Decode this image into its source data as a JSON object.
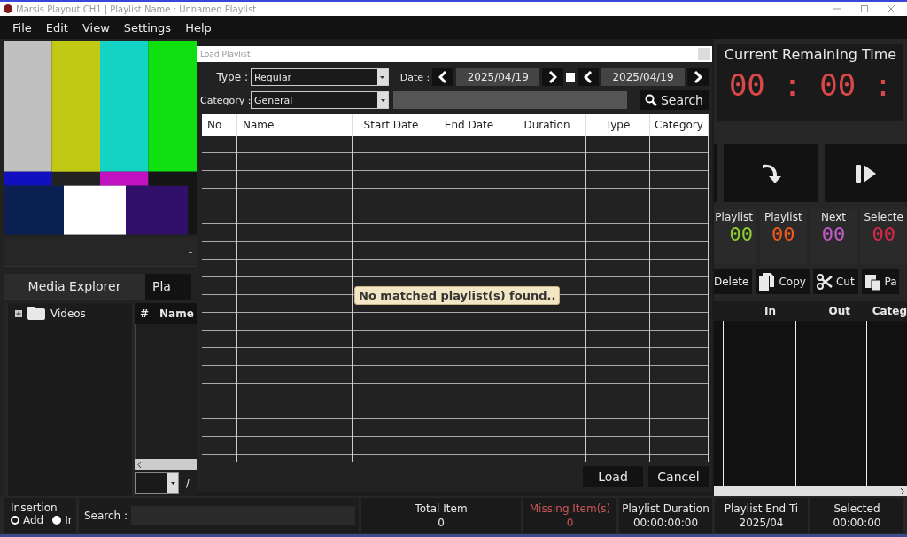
{
  "window": {
    "title": "Marsis Playout CH1 | Playlist Name : Unnamed Playlist"
  },
  "menu": [
    "File",
    "Edit",
    "View",
    "Settings",
    "Help"
  ],
  "preview": {
    "kind": "picture",
    "reading": "-"
  },
  "left_tabs": [
    {
      "label": "Media Explorer",
      "selected": true
    },
    {
      "label": "Pla",
      "selected": false
    }
  ],
  "tree": [
    {
      "label": "Videos",
      "expanded": false
    }
  ],
  "file_list": {
    "columns": [
      "#",
      "Name"
    ],
    "page_separator": "/"
  },
  "remaining_time": {
    "title": "Current Remaining Time",
    "value": "00 : 00 :"
  },
  "counters": [
    {
      "label": "Playlist",
      "value": "00",
      "color": "#8ccf2e"
    },
    {
      "label": "Playlist",
      "value": "00",
      "color": "#f05a1e"
    },
    {
      "label": "Next",
      "value": "00",
      "color": "#c35cc8"
    },
    {
      "label": "Selecte",
      "value": "00",
      "color": "#d8284a"
    }
  ],
  "edit_tools": [
    {
      "label": "Delete",
      "kind": "delete"
    },
    {
      "label": "Copy",
      "kind": "copy"
    },
    {
      "label": "Cut",
      "kind": "cut"
    },
    {
      "label": "Pa",
      "kind": "paste"
    }
  ],
  "playlist_table": {
    "columns": [
      "In",
      "Out",
      "Categ"
    ]
  },
  "insertion": {
    "title": "Insertion",
    "options": [
      {
        "label": "Add",
        "selected": true
      },
      {
        "label": "Ir",
        "selected": false
      }
    ]
  },
  "search": {
    "label": "Search :"
  },
  "stats": [
    {
      "label": "Total Item",
      "value": "0",
      "kind": "normal"
    },
    {
      "label": "Missing Item(s)",
      "value": "0",
      "kind": "warning"
    },
    {
      "label": "Playlist Duration",
      "value": "00:00:00:00",
      "kind": "normal"
    },
    {
      "label": "Playlist End Ti",
      "value": "2025/04",
      "kind": "normal"
    },
    {
      "label": "Selected",
      "value": "00:00:00",
      "kind": "normal"
    }
  ],
  "dialog": {
    "title": "Load Playlist",
    "type_label": "Type :",
    "type_value": "Regular",
    "category_label": "Category :",
    "category_value": "General",
    "date_label": "Date :",
    "date_from": "2025/04/19",
    "date_to": "2025/04/19",
    "date_range_checked": false,
    "search_button": "Search",
    "columns": [
      "No",
      "Name",
      "Start Date",
      "End Date",
      "Duration",
      "Type",
      "Category"
    ],
    "message": "No matched playlist(s) found..",
    "buttons": [
      "Load",
      "Cancel"
    ]
  }
}
